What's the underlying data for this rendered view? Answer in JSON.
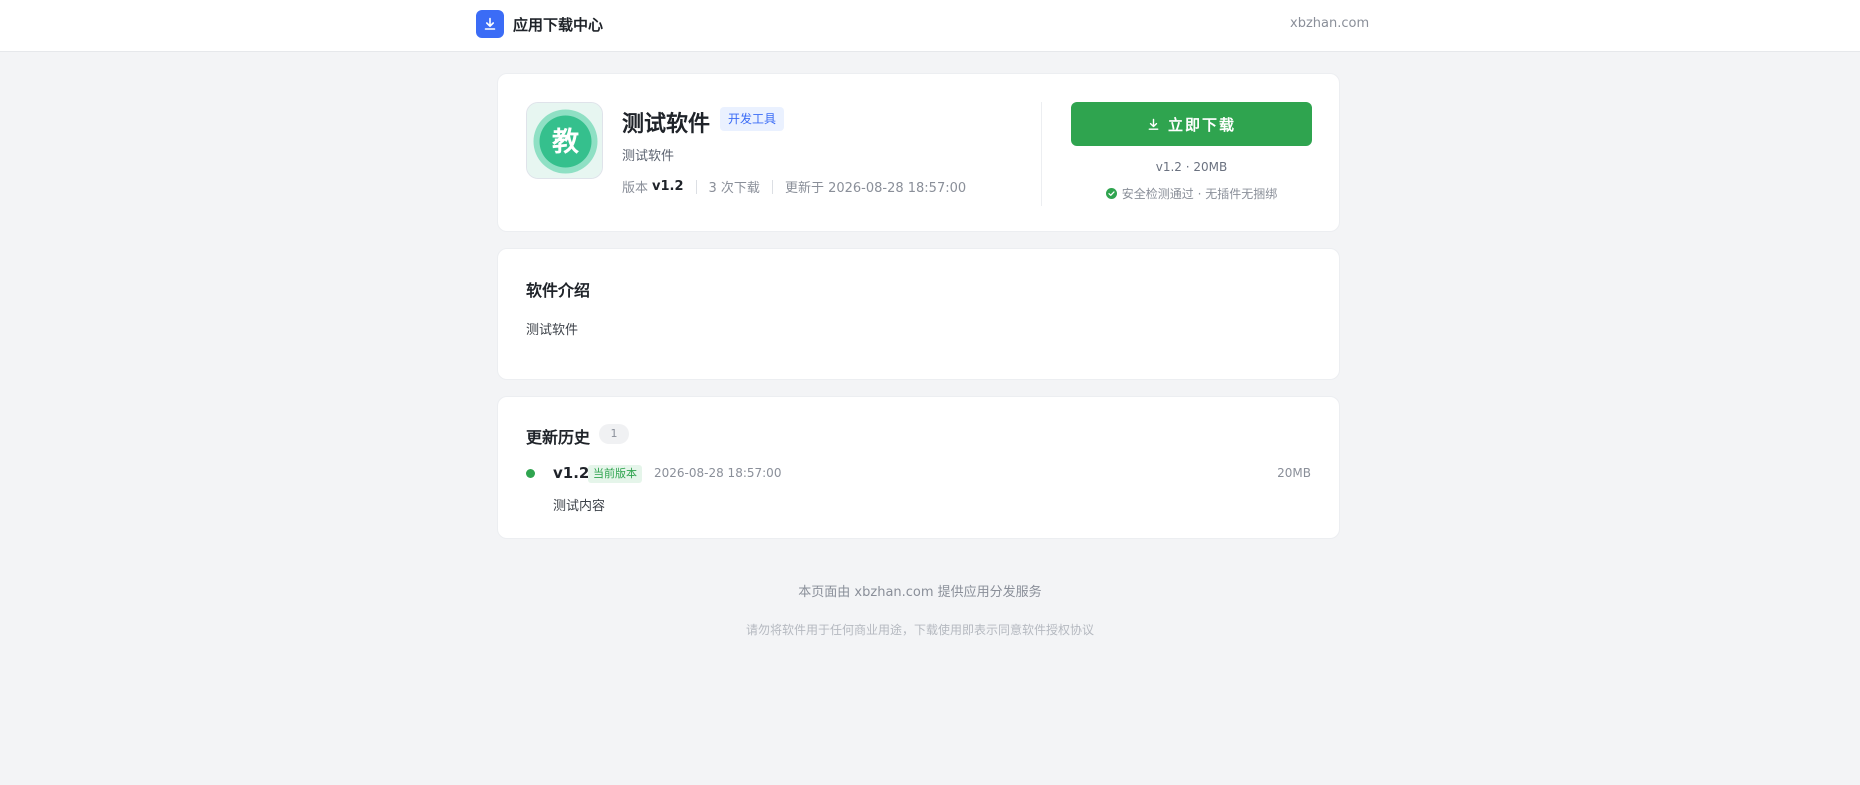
{
  "header": {
    "brand_title": "应用下载中心",
    "brand_icon": "download-icon",
    "site_domain": "xbzhan.com"
  },
  "app": {
    "name": "测试软件",
    "category_tag": "开发工具",
    "subtitle": "测试软件",
    "icon_char": "教",
    "meta": {
      "version_label": "版本",
      "version_value": "v1.2",
      "downloads": "3 次下载",
      "updated": "更新于 2026-08-28 18:57:00"
    },
    "download": {
      "button_label": "立即下载",
      "info": "v1.2 · 20MB",
      "safety_text": "安全检测通过 · 无插件无捆绑"
    }
  },
  "intro": {
    "title": "软件介绍",
    "text": "测试软件"
  },
  "history": {
    "title": "更新历史",
    "count": "1",
    "entries": [
      {
        "version": "v1.2",
        "badge": "当前版本",
        "date": "2026-08-28 18:57:00",
        "size": "20MB",
        "description": "测试内容"
      }
    ]
  },
  "footer": {
    "line1": "本页面由 xbzhan.com 提供应用分发服务",
    "line2": "请勿将软件用于任何商业用途，下载使用即表示同意软件授权协议"
  },
  "colors": {
    "brand": "#3b6cf6",
    "primary_green": "#2fa44f",
    "page_bg": "#f3f4f6"
  }
}
